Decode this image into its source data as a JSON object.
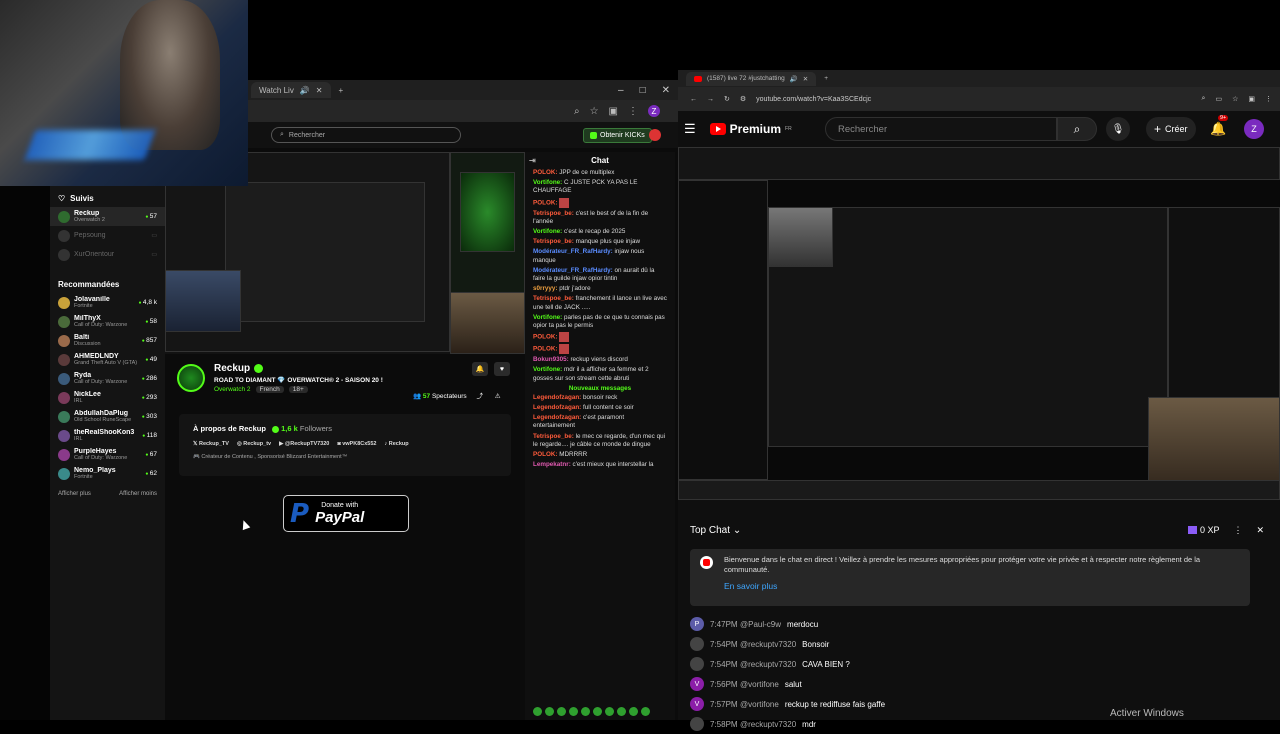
{
  "kick_browser": {
    "tab_title": "Watch Liv",
    "window_controls": [
      "–",
      "□",
      "✕"
    ],
    "search_placeholder": "Rechercher",
    "obtain_kicks": "Obtenir KICKs"
  },
  "kick_sidebar": {
    "followed_title": "Suivis",
    "followed": [
      {
        "name": "Reckup",
        "game": "Overwatch 2",
        "viewers": "57",
        "active": true
      },
      {
        "name": "Pepsoung",
        "game": "",
        "viewers": "",
        "dim": true
      },
      {
        "name": "XurOrientour",
        "game": "",
        "viewers": "",
        "dim": true
      }
    ],
    "recommended_title": "Recommandées",
    "recommended": [
      {
        "name": "Jolavanille",
        "game": "Fortnite",
        "viewers": "4,8 k"
      },
      {
        "name": "MilThyX",
        "game": "Call of Duty: Warzone",
        "viewers": "58"
      },
      {
        "name": "Balti",
        "game": "Discussion",
        "viewers": "857"
      },
      {
        "name": "AHMEDLNDY",
        "game": "Grand Theft Auto V (GTA)",
        "viewers": "49"
      },
      {
        "name": "Ryda",
        "game": "Call of Duty: Warzone",
        "viewers": "286"
      },
      {
        "name": "NickLee",
        "game": "IRL",
        "viewers": "293"
      },
      {
        "name": "AbdullahDaPlug",
        "game": "Old School RuneScape",
        "viewers": "303"
      },
      {
        "name": "theRealShooKon3",
        "game": "IRL",
        "viewers": "118"
      },
      {
        "name": "PurpleHayes",
        "game": "Call of Duty: Warzone",
        "viewers": "67"
      },
      {
        "name": "Nemo_Plays",
        "game": "Fortnite",
        "viewers": "62"
      }
    ],
    "show_more": "Afficher plus",
    "show_less": "Afficher moins"
  },
  "kick_channel": {
    "name": "Reckup",
    "title": "ROAD TO DIAMANT 💎 OVERWATCH® 2 - SAISON 20 !",
    "category": "Overwatch 2",
    "tags": [
      "French",
      "18+"
    ],
    "viewers_count": "57",
    "viewers_label": "Spectateurs",
    "about_title": "À propos de Reckup",
    "followers": "1,6 k",
    "followers_label": "Followers",
    "socials": [
      "Reckup_TV",
      "Reckup_tv",
      "@ReckupTV7320",
      "vwPK8Cx552",
      "Reckup"
    ],
    "description": "🎮 Créateur de Contenu , Sponsorisé Blizzard Entertainment™",
    "paypal_small": "Donate with",
    "paypal_big": "PayPal"
  },
  "kick_chat": {
    "title": "Chat",
    "messages": [
      {
        "user": "POLOK:",
        "color": "u-red",
        "text": "JPP de ce multiplex"
      },
      {
        "user": "Vortifone:",
        "color": "u-green",
        "text": "C JUSTE PCK YA PAS LE CHAUFFAGE"
      },
      {
        "user": "POLOK:",
        "color": "u-red",
        "text": "",
        "emote": true
      },
      {
        "user": "Tetrispoe_be:",
        "color": "u-red",
        "text": "c'est le best of de la fin de l'année"
      },
      {
        "user": "Vortifone:",
        "color": "u-green",
        "text": "c'est le recap de 2025"
      },
      {
        "user": "Tetrispoe_be:",
        "color": "u-red",
        "text": "manque plus que injaw"
      },
      {
        "user": "Modérateur_FR_RafHardy:",
        "color": "u-blue",
        "text": "injaw nous manque"
      },
      {
        "user": "Modérateur_FR_RafHardy:",
        "color": "u-blue",
        "text": "on aurait dû la faire la guilde injaw opior tintin"
      },
      {
        "user": "s0rryyy:",
        "color": "u-orange",
        "text": "ptdr j'adore"
      },
      {
        "user": "Tetrispoe_be:",
        "color": "u-red",
        "text": "franchement il lance un live avec une tell de JACK ....."
      },
      {
        "user": "Vortifone:",
        "color": "u-green",
        "text": "parles pas de ce que tu connais pas opior ta pas le permis"
      },
      {
        "user": "POLOK:",
        "color": "u-red",
        "text": "",
        "emote": true
      },
      {
        "user": "POLOK:",
        "color": "u-red",
        "text": "",
        "emote": true
      },
      {
        "user": "Bokun9305:",
        "color": "u-pink",
        "text": "reckup viens discord"
      },
      {
        "user": "Vortifone:",
        "color": "u-green",
        "text": "mdr il a afficher sa femme et 2 gosses sur son stream cette abruti"
      }
    ],
    "new_messages": "Nouveaux messages",
    "messages2": [
      {
        "user": "Legendofzagan:",
        "color": "u-red",
        "text": "bonsoir reck"
      },
      {
        "user": "Legendofzagan:",
        "color": "u-red",
        "text": "full content ce soir"
      },
      {
        "user": "Legendofzagan:",
        "color": "u-red",
        "text": "c'est paramont entertainement"
      },
      {
        "user": "Tetrispoe_be:",
        "color": "u-red",
        "text": "le mec ce regarde, d'un mec qui le regarde.... je câble ce monde de dingue"
      },
      {
        "user": "POLOK:",
        "color": "u-red",
        "text": "MDRRRR"
      },
      {
        "user": "Lempekatnr:",
        "color": "u-pink",
        "text": "c'est mieux que interstellar la"
      }
    ]
  },
  "yt_browser": {
    "tab_title": "(1587) live 72 #justchatting",
    "url": "youtube.com/watch?v=Kaa3SCEdcjc",
    "brand": "Premium",
    "brand_sup": "FR",
    "search_placeholder": "Rechercher",
    "create_label": "Créer",
    "notif_badge": "9+",
    "avatar_letter": "Z"
  },
  "yt_chat": {
    "title": "Top Chat",
    "xp": "0 XP",
    "welcome": "Bienvenue dans le chat en direct ! Veillez à prendre les mesures appropriées pour protéger votre vie privée et à respecter notre règlement de la communauté.",
    "learn_more": "En savoir plus",
    "messages": [
      {
        "avatar": "P",
        "time": "7:47PM",
        "author": "@Paul-c9w",
        "text": "merdocu",
        "color": "#5c5ca8"
      },
      {
        "avatar": "",
        "time": "7:54PM",
        "author": "@reckuptv7320",
        "text": "Bonsoir",
        "color": "#444"
      },
      {
        "avatar": "",
        "time": "7:54PM",
        "author": "@reckuptv7320",
        "text": "CAVA BIEN ?",
        "color": "#444"
      },
      {
        "avatar": "V",
        "time": "7:56PM",
        "author": "@vortifone",
        "text": "salut",
        "color": "#8b1ea8"
      },
      {
        "avatar": "V",
        "time": "7:57PM",
        "author": "@vortifone",
        "text": "reckup te rediffuse fais gaffe",
        "color": "#8b1ea8"
      },
      {
        "avatar": "",
        "time": "7:58PM",
        "author": "@reckuptv7320",
        "text": "mdr",
        "color": "#444"
      }
    ]
  },
  "os_overlay": {
    "activate_windows": "Activer Windows"
  }
}
